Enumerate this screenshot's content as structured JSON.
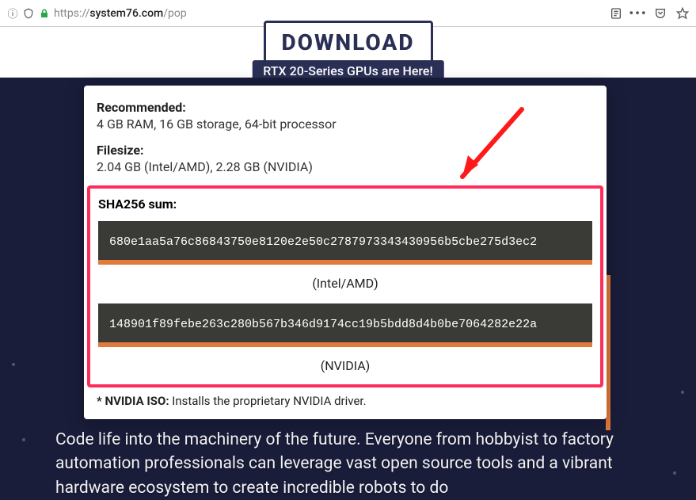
{
  "browser": {
    "url_prefix": "https://",
    "url_domain": "system76.com",
    "url_path": "/pop"
  },
  "page": {
    "download_button": "DOWNLOAD",
    "banner": "RTX 20-Series GPUs are Here!"
  },
  "modal": {
    "recommended_label": "Recommended:",
    "recommended_value": "4 GB RAM, 16 GB storage, 64-bit processor",
    "filesize_label": "Filesize:",
    "filesize_value": "2.04 GB (Intel/AMD), 2.28 GB (NVIDIA)",
    "sha_label": "SHA256 sum:",
    "hash1": "680e1aa5a76c86843750e8120e2e50c2787973343430956b5cbe275d3ec2",
    "caption1": "(Intel/AMD)",
    "hash2": "148901f89febe263c280b567b346d9174cc19b5bdd8d4b0be7064282e22a",
    "caption2": "(NVIDIA)",
    "note_strong": "* NVIDIA ISO:",
    "note_rest": " Installs the proprietary NVIDIA driver."
  },
  "body_text": "Code life into the machinery of the future. Everyone from hobbyist to factory automation professionals can leverage vast open source tools and a vibrant hardware ecosystem to create incredible robots to do"
}
